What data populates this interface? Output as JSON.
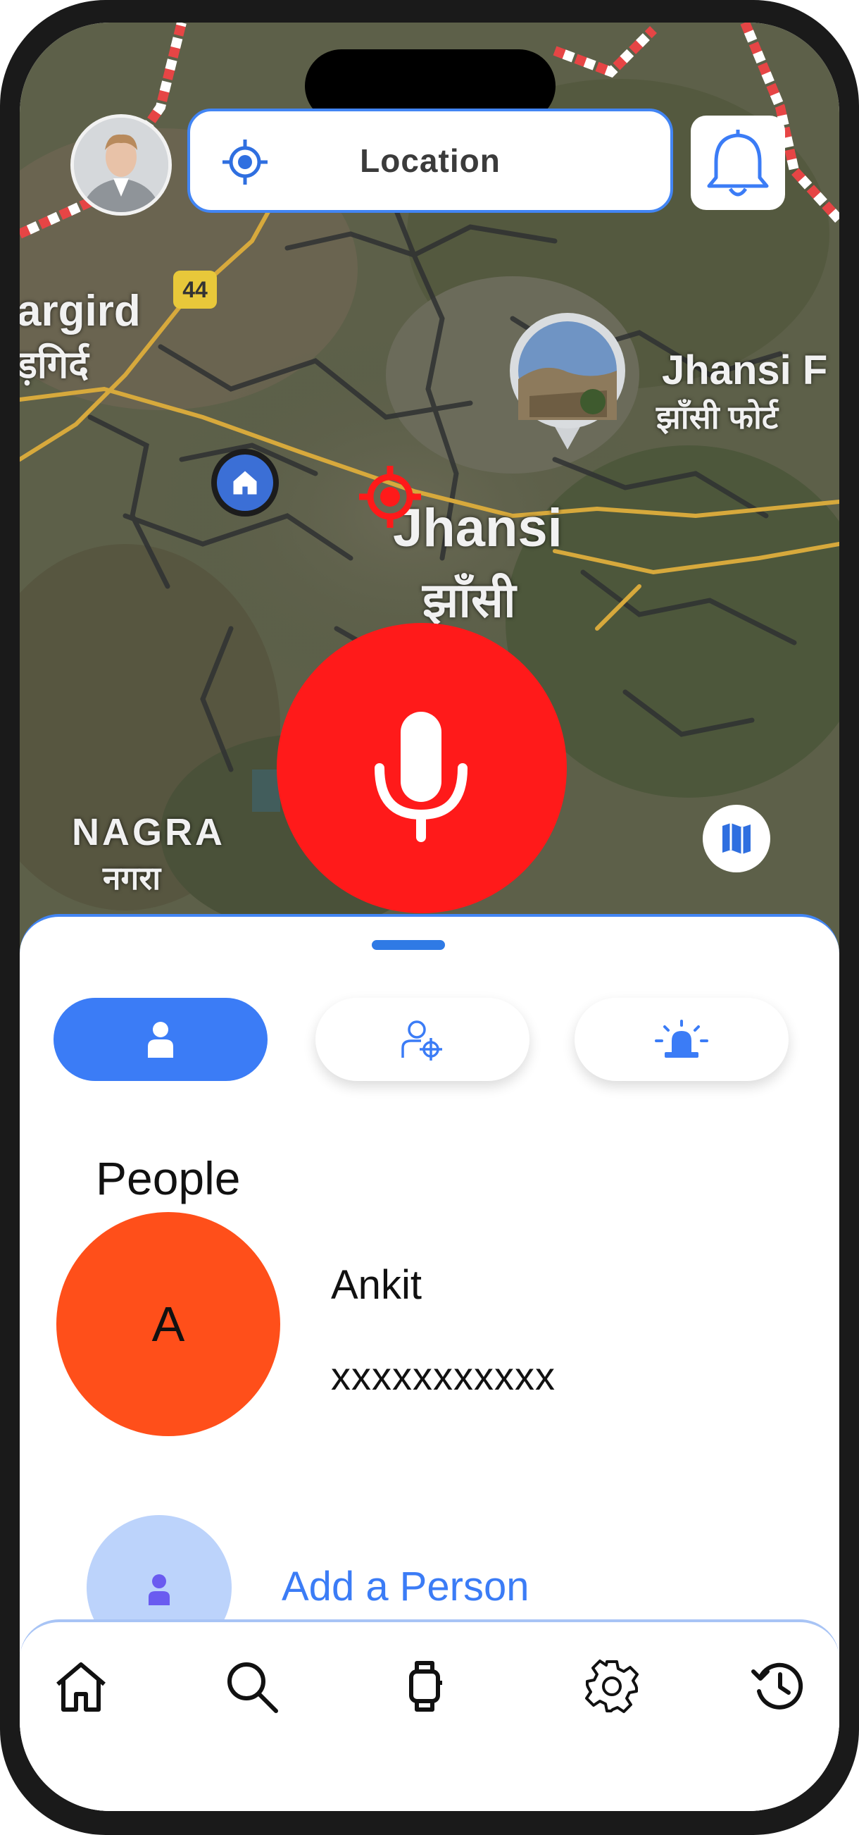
{
  "header": {
    "location_label": "Location"
  },
  "map": {
    "city_name": "Jhansi",
    "city_name_hindi": "झाँसी",
    "fort_name": "Jhansi F",
    "fort_name_hindi": "झाँसी फोर्ट",
    "area_left": "argird",
    "area_left_hindi": "ड़गिर्द",
    "area_bottom": "NAGRA",
    "area_bottom_hindi": "नगरा",
    "highway_badge": "44"
  },
  "tabs": [
    {
      "icon": "person-icon",
      "active": true
    },
    {
      "icon": "person-search-icon",
      "active": false
    },
    {
      "icon": "siren-icon",
      "active": false
    }
  ],
  "people": {
    "title": "People",
    "contacts": [
      {
        "initial": "A",
        "name": "Ankit",
        "phone": "xxxxxxxxxxx"
      }
    ],
    "add_label": "Add a Person"
  },
  "bottom_nav": [
    {
      "icon": "home-icon"
    },
    {
      "icon": "search-icon"
    },
    {
      "icon": "watch-icon"
    },
    {
      "icon": "settings-icon"
    },
    {
      "icon": "history-icon"
    }
  ],
  "colors": {
    "accent_blue": "#3b7cf6",
    "sos_red": "#ff1a1a",
    "avatar_orange": "#ff4f1a"
  }
}
